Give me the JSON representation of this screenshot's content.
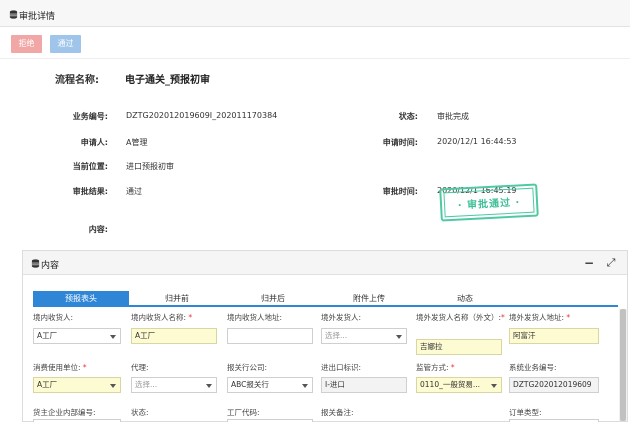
{
  "header": {
    "title": "审批详情"
  },
  "toolbar": {
    "reject_label": "拒绝",
    "pass_label": "通过"
  },
  "detail": {
    "flow_label": "流程名称:",
    "flow_value": "电子通关_预报初审",
    "business_no_label": "业务编号:",
    "business_no_value": "DZTG202012019609I_202011170384",
    "status_label": "状态:",
    "status_value": "审批完成",
    "applicant_label": "申请人:",
    "applicant_value": "A管理",
    "apply_time_label": "申请时间:",
    "apply_time_value": "2020/12/1 16:44:53",
    "position_label": "当前位置:",
    "position_value": "进口预报初审",
    "result_label": "审批结果:",
    "result_value": "通过",
    "approve_time_label": "审批时间:",
    "approve_time_value": "2020/12/1 16:45:19",
    "content_label": "内容:",
    "stamp_text": "· 审批通过 ·"
  },
  "panel": {
    "title": "内容",
    "min_label": "−",
    "expand_label": "⤢",
    "tabs": [
      "预报表头",
      "归并前",
      "归并后",
      "附件上传",
      "动态"
    ]
  },
  "form": {
    "r1": [
      {
        "label": "境内收货人:",
        "required": false,
        "value": "A工厂",
        "placeholder": "",
        "style": "select"
      },
      {
        "label": "境内收货人名称:",
        "required": true,
        "value": "A工厂",
        "placeholder": "",
        "style": "yellow"
      },
      {
        "label": "境内收货人地址:",
        "required": false,
        "value": "",
        "placeholder": "",
        "style": "plain"
      },
      {
        "label": "境外发货人:",
        "required": false,
        "value": "",
        "placeholder": "选择...",
        "style": "select"
      },
      {
        "label": "境外发货人名称（外文）:",
        "required": true,
        "value": "吉娜拉",
        "placeholder": "",
        "style": "yellow"
      },
      {
        "label": "境外发货人地址:",
        "required": true,
        "value": "阿富汗",
        "placeholder": "",
        "style": "yellow"
      }
    ],
    "r2": [
      {
        "label": "消费使用单位:",
        "required": true,
        "value": "A工厂",
        "placeholder": "",
        "style": "yellow-select"
      },
      {
        "label": "代理:",
        "required": false,
        "value": "",
        "placeholder": "选择...",
        "style": "select"
      },
      {
        "label": "报关行公司:",
        "required": false,
        "value": "ABC报关行",
        "placeholder": "",
        "style": "select"
      },
      {
        "label": "进出口标识:",
        "required": false,
        "value": "I-进口",
        "placeholder": "",
        "style": "gray"
      },
      {
        "label": "监管方式:",
        "required": true,
        "value": "0110_一般贸易...",
        "placeholder": "",
        "style": "yellow-select"
      },
      {
        "label": "系统业务编号:",
        "required": false,
        "value": "DZTG202012019609",
        "placeholder": "",
        "style": "gray"
      }
    ],
    "r3": [
      {
        "label": "货主企业内部编号:",
        "required": false
      },
      {
        "label": "状态:",
        "required": false
      },
      {
        "label": "工厂代码:",
        "required": false
      },
      {
        "label": "报关备注:",
        "required": false
      },
      {
        "label": "",
        "required": false
      },
      {
        "label": "订单类型:",
        "required": false
      }
    ]
  },
  "colors": {
    "accent": "#2f86d6",
    "stamp": "#3fbf98",
    "reject": "#f2a7a7",
    "pass": "#9fc6ea",
    "required_bg": "#fdfbd2"
  },
  "icons": {
    "header": "database-icon",
    "panel": "database-icon",
    "minimize": "minus-icon",
    "expand": "expand-icon"
  }
}
